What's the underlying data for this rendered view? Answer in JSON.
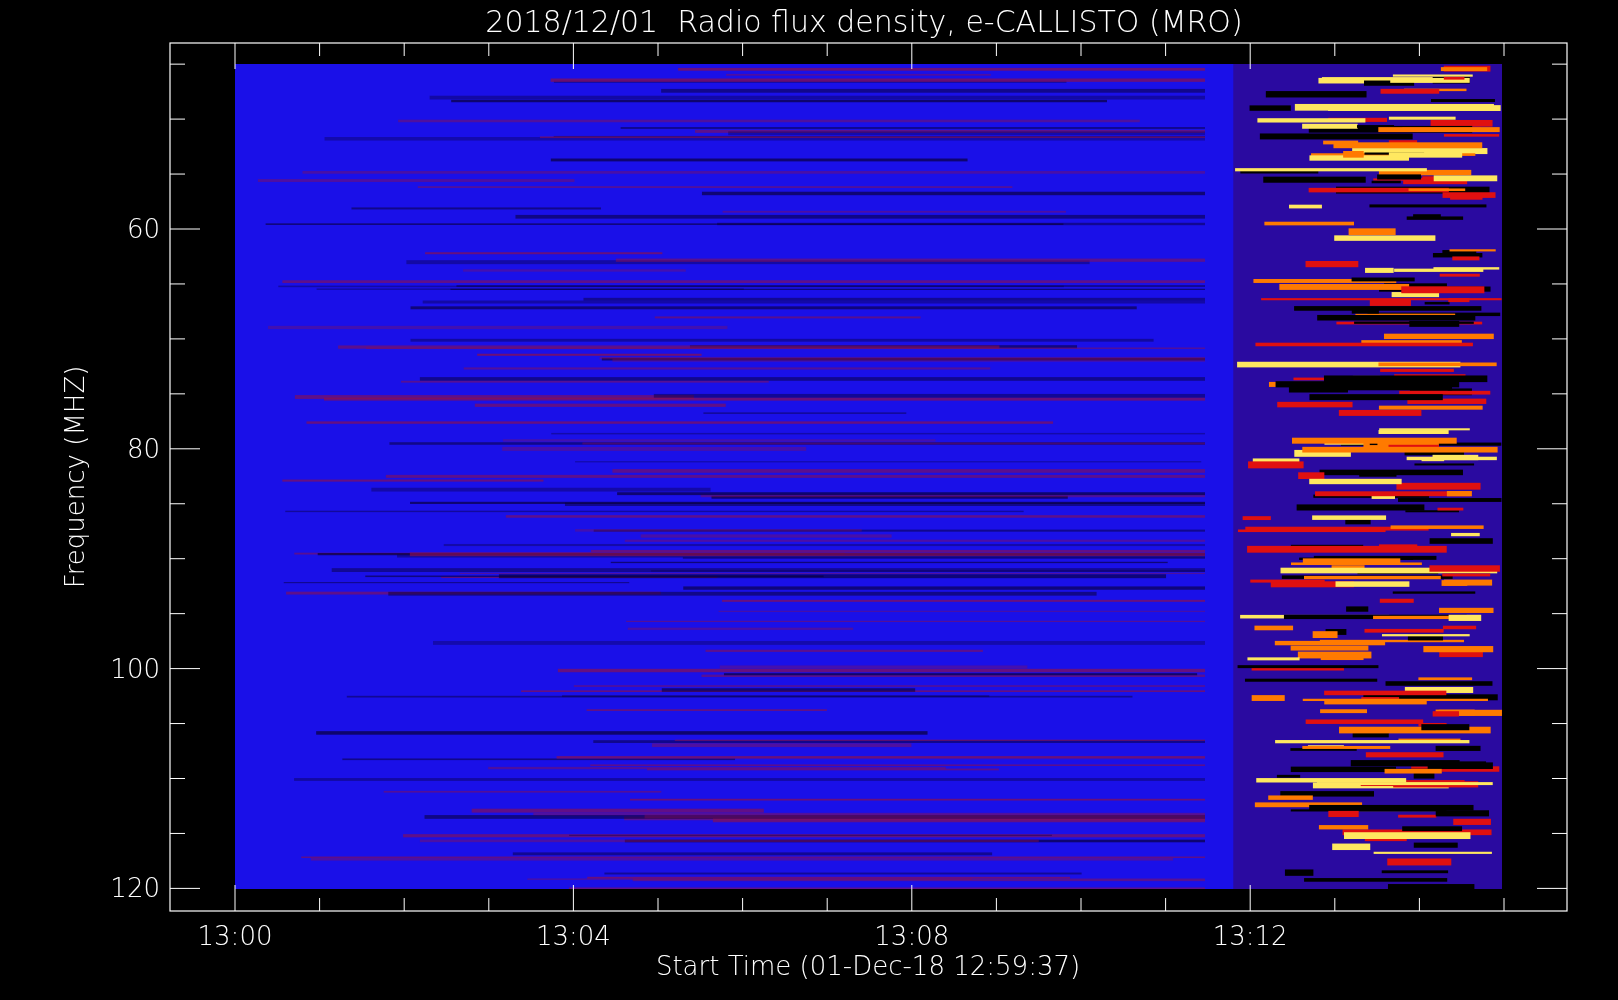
{
  "title": "2018/12/01  Radio flux density, e-CALLISTO (MRO)",
  "ylabel": "Frequency (MHZ)",
  "xlabel": "Start Time (01-Dec-18 12:59:37)",
  "yticks": [
    "60",
    "80",
    "100",
    "120"
  ],
  "xticks": [
    "13:00",
    "13:04",
    "13:08",
    "13:12"
  ]
}
